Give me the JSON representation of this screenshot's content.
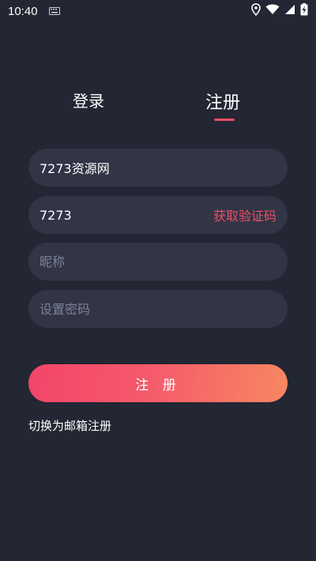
{
  "status_bar": {
    "time": "10:40",
    "icons": [
      "keyboard-icon",
      "location-icon",
      "wifi-icon",
      "signal-icon",
      "battery-charging-icon"
    ]
  },
  "tabs": [
    {
      "label": "登录",
      "active": false
    },
    {
      "label": "注册",
      "active": true
    }
  ],
  "form": {
    "username": {
      "value": "7273资源网",
      "placeholder": ""
    },
    "code": {
      "value": "7273",
      "placeholder": "",
      "action_label": "获取验证码"
    },
    "nickname": {
      "value": "",
      "placeholder": "昵称"
    },
    "password": {
      "value": "",
      "placeholder": "设置密码"
    }
  },
  "submit_label": "注 册",
  "switch_label": "切换为邮箱注册",
  "colors": {
    "background": "#232633",
    "field": "#313546",
    "accent": "#ef4d66",
    "gradient_end": "#f78862"
  }
}
